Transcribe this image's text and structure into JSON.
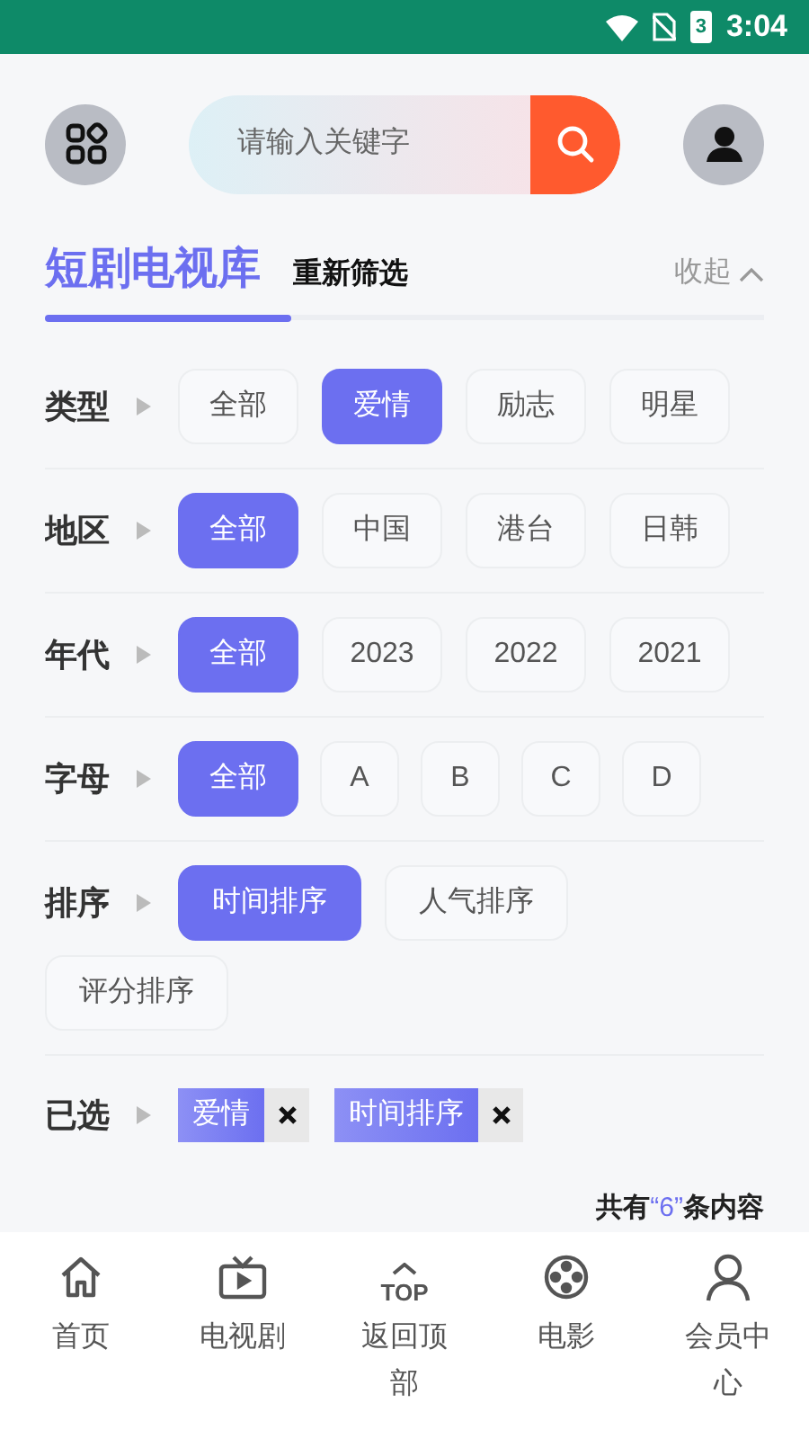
{
  "status_bar": {
    "battery": "3",
    "time": "3:04"
  },
  "search": {
    "placeholder": "请输入关键字"
  },
  "header": {
    "title": "短剧电视库",
    "reset": "重新筛选",
    "collapse": "收起"
  },
  "filters": [
    {
      "label": "类型",
      "kind": "scroll",
      "options": [
        {
          "label": "全部",
          "selected": false
        },
        {
          "label": "爱情",
          "selected": true
        },
        {
          "label": "励志",
          "selected": false
        },
        {
          "label": "明星",
          "selected": false
        }
      ]
    },
    {
      "label": "地区",
      "kind": "scroll",
      "options": [
        {
          "label": "全部",
          "selected": true
        },
        {
          "label": "中国",
          "selected": false
        },
        {
          "label": "港台",
          "selected": false
        },
        {
          "label": "日韩",
          "selected": false
        }
      ]
    },
    {
      "label": "年代",
      "kind": "scroll",
      "options": [
        {
          "label": "全部",
          "selected": true
        },
        {
          "label": "2023",
          "selected": false
        },
        {
          "label": "2022",
          "selected": false
        },
        {
          "label": "2021",
          "selected": false
        }
      ]
    },
    {
      "label": "字母",
      "kind": "letters",
      "options": [
        {
          "label": "全部",
          "selected": true
        },
        {
          "label": "A",
          "selected": false
        },
        {
          "label": "B",
          "selected": false
        },
        {
          "label": "C",
          "selected": false
        },
        {
          "label": "D",
          "selected": false
        }
      ]
    },
    {
      "label": "排序",
      "kind": "wrap",
      "options": [
        {
          "label": "时间排序",
          "selected": true
        },
        {
          "label": "人气排序",
          "selected": false
        },
        {
          "label": "评分排序",
          "selected": false
        }
      ]
    }
  ],
  "chosen": {
    "label": "已选",
    "tags": [
      "爱情",
      "时间排序"
    ]
  },
  "result_count": {
    "prefix": "共有",
    "count": "“6”",
    "suffix": "条内容"
  },
  "nav": [
    {
      "kind": "home",
      "label": "首页"
    },
    {
      "kind": "tv",
      "label": "电视剧"
    },
    {
      "kind": "top",
      "icon_text": "TOP",
      "label": "返回顶部"
    },
    {
      "kind": "film",
      "label": "电影"
    },
    {
      "kind": "user",
      "label": "会员中心"
    }
  ]
}
